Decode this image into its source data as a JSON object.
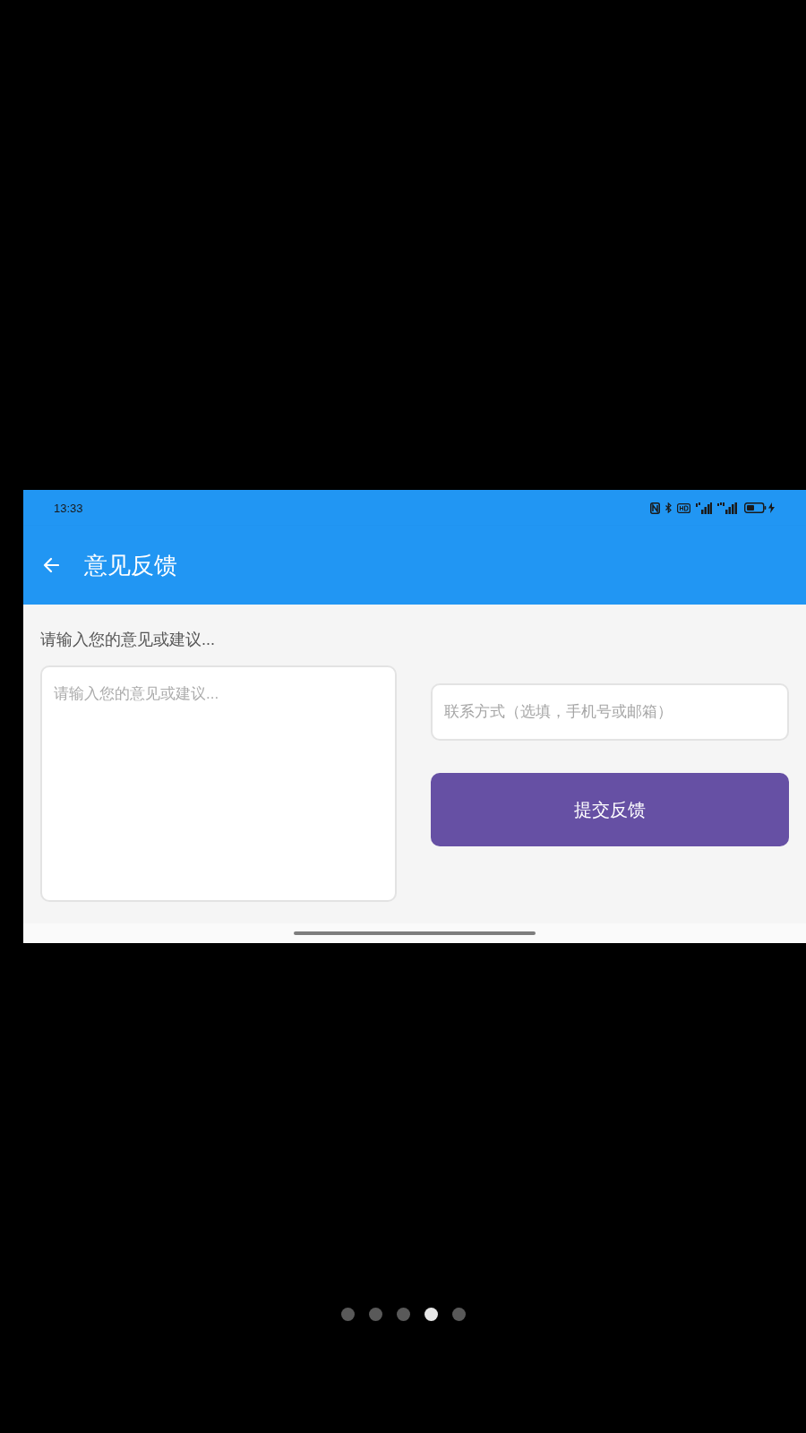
{
  "status_bar": {
    "time": "13:33"
  },
  "app_bar": {
    "title": "意见反馈"
  },
  "feedback": {
    "label": "请输入您的意见或建议...",
    "placeholder": "请输入您的意见或建议..."
  },
  "contact": {
    "placeholder": "联系方式（选填，手机号或邮箱）"
  },
  "submit_button": {
    "label": "提交反馈"
  },
  "pager": [
    {
      "selected": false
    },
    {
      "selected": false
    },
    {
      "selected": false
    },
    {
      "selected": true
    },
    {
      "selected": false
    }
  ]
}
